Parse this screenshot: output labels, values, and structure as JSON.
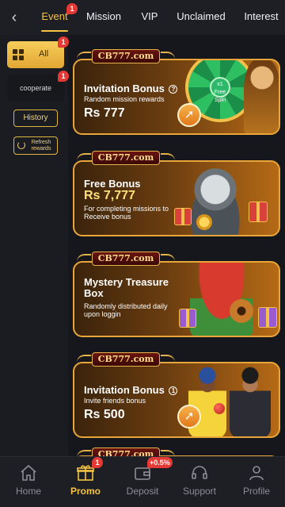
{
  "tabs": [
    {
      "label": "Event",
      "badge": "1",
      "active": true
    },
    {
      "label": "Mission"
    },
    {
      "label": "VIP"
    },
    {
      "label": "Unclaimed"
    },
    {
      "label": "Interest"
    }
  ],
  "sidebar": {
    "all": {
      "label": "All",
      "badge": "1"
    },
    "cooperate": {
      "label": "cooperate",
      "badge": "1"
    },
    "history_label": "History",
    "refresh_label": "Refresh rewards"
  },
  "cards": [
    {
      "logo": "CB777.com",
      "title": "Invitation Bonus",
      "title_icon": "?",
      "subtitle": "Random mission rewards",
      "amount": "Rs 777"
    },
    {
      "logo": "CB777.com",
      "title": "Free Bonus",
      "amount": "Rs 7,777",
      "subtitle": "For completing missions to Receive bonus"
    },
    {
      "logo": "CB777.com",
      "title": "Mystery Treasure Box",
      "subtitle": "Randomly distributed daily upon loggin"
    },
    {
      "logo": "CB777.com",
      "title": "Invitation Bonus",
      "title_icon": "1",
      "subtitle": "Invite friends bonus",
      "amount": "Rs 500"
    }
  ],
  "wheel_hub_text": "x1 Free Spin",
  "bottom_nav": [
    {
      "label": "Home",
      "icon": "home-icon"
    },
    {
      "label": "Promo",
      "icon": "gift-icon",
      "badge": "1",
      "active": true
    },
    {
      "label": "Deposit",
      "icon": "wallet-icon",
      "badge": "+0.5%"
    },
    {
      "label": "Support",
      "icon": "headset-icon"
    },
    {
      "label": "Profile",
      "icon": "person-icon"
    }
  ],
  "colors": {
    "accent": "#f6c343",
    "badge": "#e53935",
    "background": "#16171c"
  }
}
